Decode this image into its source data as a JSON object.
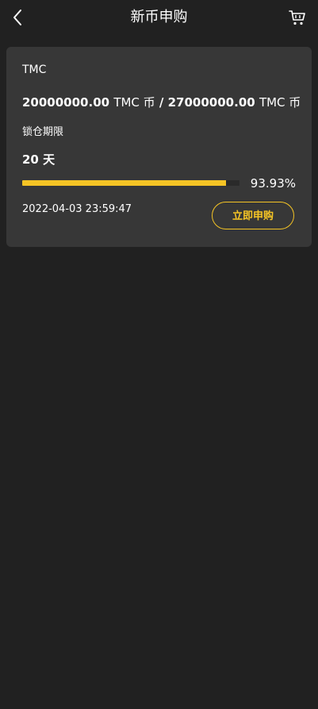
{
  "header": {
    "title": "新币申购",
    "back_icon": "chevron-left-icon",
    "cart_icon": "cart-icon"
  },
  "card": {
    "coin_name": "TMC",
    "subscribed_amount": "20000000.00",
    "total_amount": "27000000.00",
    "amount_unit": "TMC 币",
    "separator": "/",
    "lock_label": "锁仓期限",
    "lock_value": "20 天",
    "progress": 0.9393,
    "progress_text": "93.93%",
    "date": "2022-04-03 23:59:47",
    "subscribe_label": "立即申购"
  },
  "colors": {
    "background": "#212121",
    "card": "#373737",
    "accent": "#f5c425",
    "text": "#ffffff"
  }
}
